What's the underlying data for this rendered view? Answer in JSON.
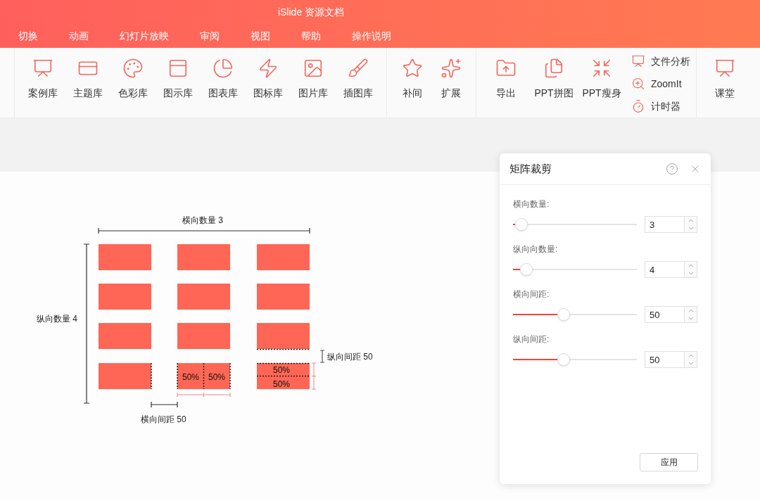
{
  "window": {
    "title": "iSlide 资源文档"
  },
  "menu": [
    "切换",
    "动画",
    "幻灯片放映",
    "审阅",
    "视图",
    "帮助",
    "操作说明"
  ],
  "toolbar": {
    "groups": [
      {
        "items": [
          "案例库",
          "主题库",
          "色彩库",
          "图示库",
          "图表库",
          "图标库",
          "图片库",
          "插图库"
        ]
      },
      {
        "items": [
          "补间",
          "扩展"
        ]
      },
      {
        "items": [
          "导出",
          "PPT拼图",
          "PPT瘦身"
        ],
        "small_items": [
          "文件分析",
          "ZoomIt",
          "计时器"
        ]
      },
      {
        "items": [
          "课堂"
        ]
      }
    ]
  },
  "diagram": {
    "columns_label": "横向数量 3",
    "rows_label": "纵向数量 4",
    "h_gap_label": "横向间距 50",
    "v_gap_label": "纵向间距 50",
    "percent_labels": [
      "50%",
      "50%",
      "50%",
      "50%"
    ]
  },
  "panel": {
    "title": "矩阵裁剪",
    "fields": [
      {
        "label": "横向数量:",
        "value": "3",
        "level": 0.07
      },
      {
        "label": "纵向向数量:",
        "value": "4",
        "level": 0.11
      },
      {
        "label": "横向间距:",
        "value": "50",
        "level": 0.41
      },
      {
        "label": "纵向间距:",
        "value": "50",
        "level": 0.41
      }
    ],
    "apply_button": "应用"
  }
}
